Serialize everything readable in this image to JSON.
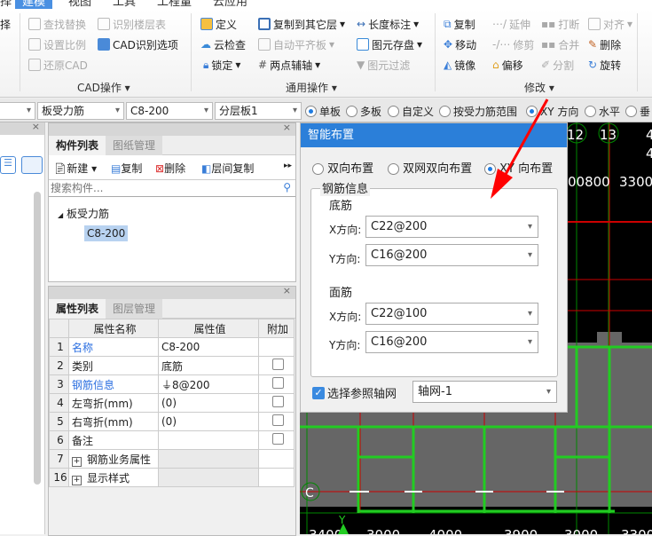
{
  "tabs": {
    "partial": "择",
    "items": [
      "建模",
      "视图",
      "工具",
      "工程量",
      "云应用"
    ]
  },
  "ribbon": {
    "cad": {
      "find_replace": "查找替换",
      "identify_floor": "识别楼层表",
      "set_scale": "设置比例",
      "cad_options": "CAD识别选项",
      "restore_cad": "还原CAD",
      "label": "CAD操作"
    },
    "common": {
      "define": "定义",
      "copy_to_floor": "复制到其它层",
      "length_mark": "长度标注",
      "cloud_check": "云检查",
      "auto_align": "自动平齐板",
      "save_element": "图元存盘",
      "lock": "锁定",
      "two_point_axis": "两点辅轴",
      "filter": "图元过滤",
      "label": "通用操作"
    },
    "modify": {
      "copy": "复制",
      "extend": "延伸",
      "break": "打断",
      "align": "对齐",
      "move": "移动",
      "trim": "修剪",
      "merge": "合并",
      "delete": "删除",
      "mirror": "镜像",
      "offset": "偏移",
      "split": "分割",
      "rotate": "旋转",
      "label": "修改"
    }
  },
  "toolbar": {
    "type": "板受力筋",
    "spec": "C8-200",
    "layer": "分层板1",
    "options": [
      "单板",
      "多板",
      "自定义",
      "按受力筋范围",
      "XY 方向",
      "水平",
      "垂"
    ]
  },
  "component_panel": {
    "tabs": [
      "构件列表",
      "图纸管理"
    ],
    "actions": {
      "new": "新建",
      "copy": "复制",
      "delete": "删除",
      "floor_copy": "层间复制"
    },
    "search_placeholder": "搜索构件...",
    "tree": {
      "parent": "板受力筋",
      "child": "C8-200"
    }
  },
  "property_panel": {
    "tabs": [
      "属性列表",
      "图层管理"
    ],
    "headers": [
      "属性名称",
      "属性值",
      "附加"
    ],
    "rows": [
      {
        "n": "1",
        "name": "名称",
        "value": "C8-200"
      },
      {
        "n": "2",
        "name": "类别",
        "value": "底筋"
      },
      {
        "n": "3",
        "name": "钢筋信息",
        "value": "⏚8@200"
      },
      {
        "n": "4",
        "name": "左弯折(mm)",
        "value": "(0)"
      },
      {
        "n": "5",
        "name": "右弯折(mm)",
        "value": "(0)"
      },
      {
        "n": "6",
        "name": "备注",
        "value": ""
      },
      {
        "n": "7",
        "name": "钢筋业务属性",
        "value": ""
      },
      {
        "n": "16",
        "name": "显示样式",
        "value": ""
      }
    ]
  },
  "dialog": {
    "title": "智能布置",
    "modes": [
      "双向布置",
      "双网双向布置",
      "XY 向布置"
    ],
    "group": "钢筋信息",
    "bottom": "底筋",
    "top": "面筋",
    "x_label": "X方向:",
    "y_label": "Y方向:",
    "bottom_x": "C22@200",
    "bottom_y": "C16@200",
    "top_x": "C22@100",
    "top_y": "C16@200",
    "ref_axis_label": "选择参照轴网",
    "ref_axis": "轴网-1"
  },
  "canvas": {
    "axis_top": [
      "12",
      "13",
      "4",
      "4"
    ],
    "dims_top": [
      "00800",
      "3300"
    ],
    "axis_left": "C",
    "dims_bottom": [
      "3400",
      "3000",
      "4000",
      "3900",
      "3000",
      "3300"
    ],
    "y_axis": "Y"
  },
  "colors": {
    "accent": "#2b7fd9",
    "grid_green": "#22cc22",
    "grid_red": "#dd0000"
  }
}
